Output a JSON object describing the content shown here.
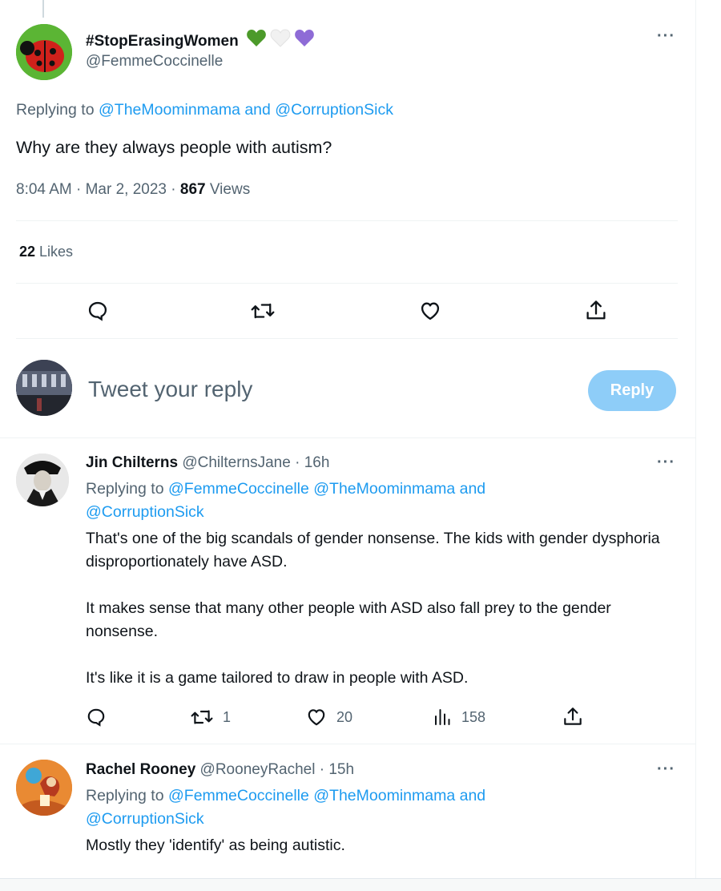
{
  "main_tweet": {
    "display_name": "#StopErasingWomen",
    "name_emojis": [
      "green-heart",
      "white-heart",
      "purple-heart"
    ],
    "handle": "@FemmeCoccinelle",
    "replying_prefix": "Replying to ",
    "replying_1": "@TheMoominmama",
    "replying_and": " and ",
    "replying_2": "@CorruptionSick",
    "text": "Why are they always people with autism?",
    "time": "8:04 AM · Mar 2, 2023 · ",
    "views_count": "867",
    "views_label": " Views",
    "likes_count": "22",
    "likes_label": " Likes"
  },
  "composer": {
    "placeholder": "Tweet your reply",
    "reply_button": "Reply"
  },
  "replies": [
    {
      "display_name": "Jin Chilterns",
      "handle": "@ChilternsJane",
      "time": " · 16h",
      "replying_prefix": "Replying to ",
      "replying_1": "@FemmeCoccinelle",
      "replying_2": "@TheMoominmama",
      "replying_and": " and",
      "replying_3": "@CorruptionSick",
      "paragraphs": [
        "That's one of the big scandals of gender nonsense. The kids with gender dysphoria disproportionately have ASD.",
        "It makes sense that many other people with ASD also fall prey to the gender nonsense.",
        "It's like it is a game tailored to draw in people with ASD."
      ],
      "retweets": "1",
      "likes": "20",
      "views": "158"
    },
    {
      "display_name": "Rachel Rooney",
      "handle": "@RooneyRachel",
      "time": " · 15h",
      "replying_prefix": "Replying to ",
      "replying_1": "@FemmeCoccinelle",
      "replying_2": "@TheMoominmama",
      "replying_and": " and",
      "replying_3": "@CorruptionSick",
      "text": "Mostly they 'identify' as being autistic."
    }
  ],
  "colors": {
    "accent": "#1d9bf0",
    "reply_button_bg": "#8ecdf8",
    "muted": "#536471",
    "green_heart": "#4c9a2a",
    "purple_heart": "#8e6bd6"
  }
}
